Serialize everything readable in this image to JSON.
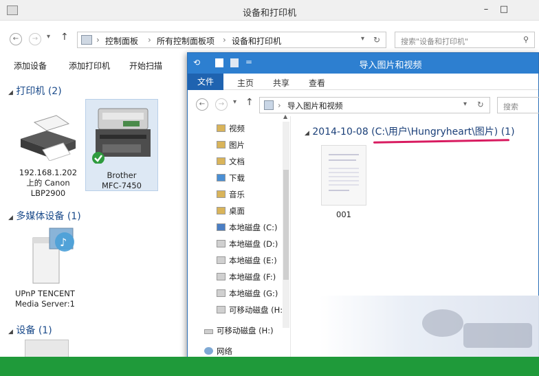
{
  "main_window": {
    "title": "设备和打印机",
    "breadcrumb": [
      "控制面板",
      "所有控制面板项",
      "设备和打印机"
    ],
    "search_placeholder": "搜索\"设备和打印机\"",
    "toolbar": [
      "添加设备",
      "添加打印机",
      "开始扫描"
    ],
    "groups": {
      "printers": "打印机 (2)",
      "media": "多媒体设备 (1)",
      "devices": "设备 (1)"
    },
    "devices": {
      "canon": "192.168.1.202\n上的 Canon\nLBP2900",
      "brother": "Brother\nMFC-7450",
      "upnp": "UPnP TENCENT\nMedia Server:1"
    }
  },
  "import_window": {
    "title": "导入图片和视频",
    "ribbon_tabs": [
      "文件",
      "主页",
      "共享",
      "查看"
    ],
    "address": "导入图片和视频",
    "search_placeholder": "搜索",
    "nav_items": [
      {
        "label": "视频",
        "icon": "videos-folder-icon"
      },
      {
        "label": "图片",
        "icon": "pictures-folder-icon"
      },
      {
        "label": "文档",
        "icon": "documents-folder-icon"
      },
      {
        "label": "下载",
        "icon": "downloads-folder-icon"
      },
      {
        "label": "音乐",
        "icon": "music-folder-icon"
      },
      {
        "label": "桌面",
        "icon": "desktop-folder-icon"
      },
      {
        "label": "本地磁盘 (C:)",
        "icon": "system-drive-icon"
      },
      {
        "label": "本地磁盘 (D:)",
        "icon": "drive-icon"
      },
      {
        "label": "本地磁盘 (E:)",
        "icon": "drive-icon"
      },
      {
        "label": "本地磁盘 (F:)",
        "icon": "drive-icon"
      },
      {
        "label": "本地磁盘 (G:)",
        "icon": "drive-icon"
      },
      {
        "label": "可移动磁盘 (H:",
        "icon": "removable-drive-icon"
      }
    ],
    "nav_removable": "可移动磁盘 (H:)",
    "nav_network": "网络",
    "group_header": "2014-10-08 (C:\\用户\\Hungryheart\\图片) (1)",
    "files": [
      {
        "name": "001"
      }
    ]
  },
  "colors": {
    "titlebar_blue": "#2d7fd0",
    "annotation_underline": "#d81b60",
    "taskbar_green": "#1f9a3a"
  }
}
